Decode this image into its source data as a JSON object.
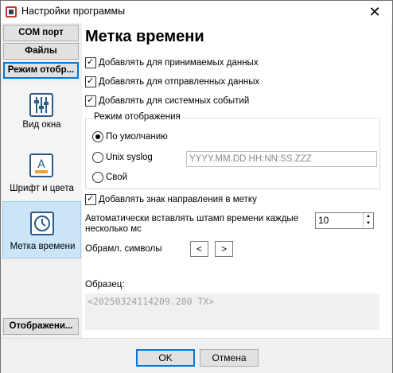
{
  "window": {
    "title": "Настройки программы",
    "close_glyph": "✕"
  },
  "sidebar": {
    "top_buttons": [
      {
        "label": "COM порт"
      },
      {
        "label": "Файлы"
      },
      {
        "label": "Режим отобр..."
      }
    ],
    "items": [
      {
        "label": "Вид окна",
        "icon": "sliders-icon"
      },
      {
        "label": "Шрифт и цвета",
        "icon": "font-color-icon"
      },
      {
        "label": "Метка времени",
        "icon": "clock-icon",
        "selected": true
      }
    ],
    "bottom_button": {
      "label": "Отображени..."
    }
  },
  "panel": {
    "heading": "Метка времени",
    "checkboxes": [
      {
        "label": "Добавлять для принимаемых данных",
        "checked": true
      },
      {
        "label": "Добавлять для отправленных данных",
        "checked": true
      },
      {
        "label": "Добавлять для системных событий",
        "checked": true
      }
    ],
    "mode_group": {
      "title": "Режим отображения",
      "options": [
        {
          "label": "По умолчанию",
          "selected": true
        },
        {
          "label": "Unix syslog",
          "selected": false
        },
        {
          "label": "Свой",
          "selected": false
        }
      ],
      "format_placeholder": "YYYY.MM.DD HH:NN:SS.ZZZ"
    },
    "direction_checkbox": {
      "label": "Добавлять знак направления в метку",
      "checked": true
    },
    "auto_insert": {
      "label_line1": "Автоматически вставлять штамп времени каждые",
      "label_line2": "несколько мс",
      "value": "10"
    },
    "frame_symbols": {
      "label": "Обрамл. символы",
      "left": "<",
      "right": ">"
    },
    "sample": {
      "label": "Образец:",
      "text": "<20250324114209.280 TX>"
    }
  },
  "footer": {
    "ok_label": "OK",
    "cancel_label": "Отмена"
  }
}
